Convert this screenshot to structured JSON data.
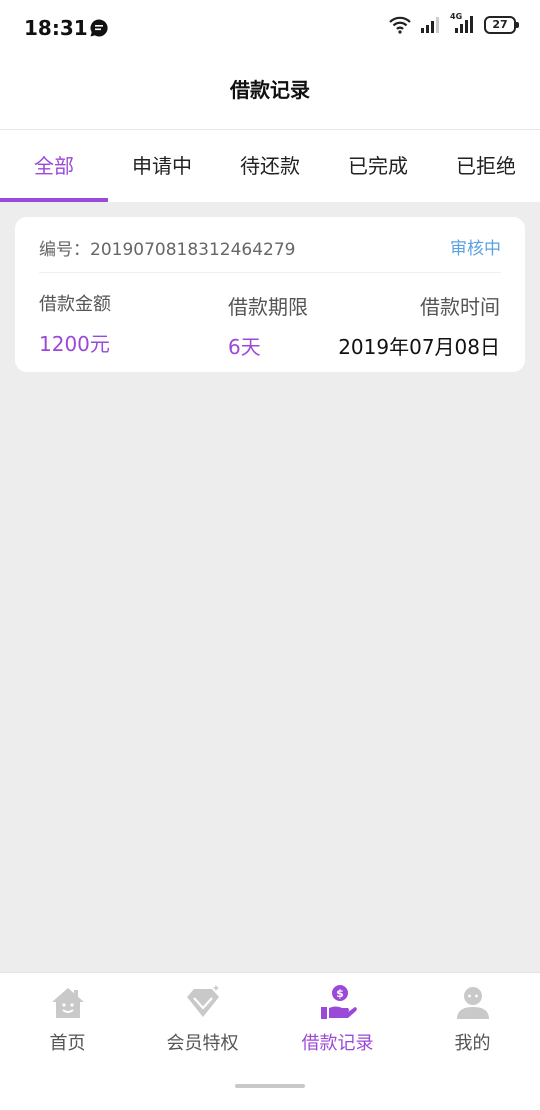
{
  "status_bar": {
    "time": "18:31",
    "network": "4G",
    "battery": "27",
    "icons": [
      "message-icon",
      "wifi-icon",
      "signal-icon",
      "signal-4g-icon",
      "battery-icon"
    ]
  },
  "header": {
    "title": "借款记录"
  },
  "tabs": [
    {
      "label": "全部",
      "active": true
    },
    {
      "label": "申请中",
      "active": false
    },
    {
      "label": "待还款",
      "active": false
    },
    {
      "label": "已完成",
      "active": false
    },
    {
      "label": "已拒绝",
      "active": false
    }
  ],
  "record": {
    "order_label": "编号：2019070818312464279",
    "status": "审核中",
    "amount_label": "借款金额",
    "amount_value": "1200元",
    "term_label": "借款期限",
    "term_value": "6天",
    "time_label": "借款时间",
    "time_value": "2019年07月08日"
  },
  "bottom_nav": [
    {
      "label": "首页",
      "icon": "home-icon",
      "active": false
    },
    {
      "label": "会员特权",
      "icon": "diamond-icon",
      "active": false
    },
    {
      "label": "借款记录",
      "icon": "loan-hand-icon",
      "active": true
    },
    {
      "label": "我的",
      "icon": "user-icon",
      "active": false
    }
  ],
  "colors": {
    "accent": "#9b49d8",
    "status_blue": "#5aa2e3",
    "background": "#ededed"
  }
}
